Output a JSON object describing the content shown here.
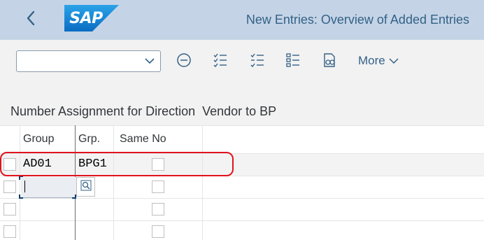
{
  "shell": {
    "logo_text": "SAP",
    "title": "New Entries: Overview of Added Entries",
    "back_icon": "chevron-left-icon",
    "colors": {
      "shell_bg": "#c4d4e6",
      "logo_blue": "#1a7fd1",
      "title": "#346187"
    }
  },
  "toolbar": {
    "dropdown_value": "",
    "icons": [
      "minus-circle-icon",
      "select-all-icon",
      "deselect-all-icon",
      "list-details-icon",
      "find-icon"
    ],
    "more_label": "More"
  },
  "section": {
    "title": "Number Assignment for Direction  Vendor to BP"
  },
  "table": {
    "headers": {
      "group": "Group",
      "grp": "Grp.",
      "same_no": "Same No"
    },
    "rows": [
      {
        "group": "AD01",
        "grp": "BPG1",
        "same_no": false
      },
      {
        "group": "",
        "grp": "",
        "same_no": false
      },
      {
        "group": "",
        "grp": "",
        "same_no": false
      },
      {
        "group": "",
        "grp": "",
        "same_no": false
      }
    ]
  }
}
